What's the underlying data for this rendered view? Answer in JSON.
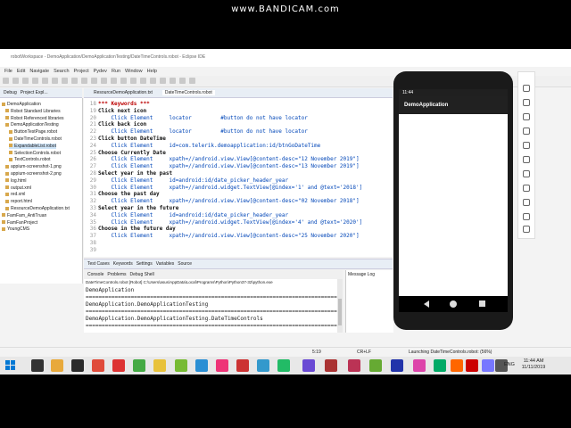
{
  "watermark": "www.BANDICAM.com",
  "window_title": "robotWorkspace - DemoApplication/DemoApplicationTesting/DateTimeControls.robot - Eclipse IDE",
  "menu": [
    "File",
    "Edit",
    "Navigate",
    "Search",
    "Project",
    "Pydev",
    "Run",
    "Window",
    "Help"
  ],
  "explorer_tabs": [
    "Debug",
    "Project Expl..."
  ],
  "explorer_items": [
    "DemoApplication",
    "Robot Standard Libraries",
    "Robot Referenced libraries",
    "DemoApplicationTesting",
    "ButtonTestPage.robot",
    "DateTimeControls.robot",
    "ExpandableList.robot",
    "SelectionControls.robot",
    "TextControls.robot",
    "appium-screenshot-1.png",
    "appium-screenshot-2.png",
    "log.html",
    "output.xml",
    "red.xml",
    "report.html",
    "ResourceDemoApplication.txt",
    "FamFam_AntiTruan",
    "FamFanProject",
    "YoungCMS"
  ],
  "editor_tabs": [
    "ResourceDemoApplication.txt",
    "DateTimeControls.robot"
  ],
  "code_lines": [
    {
      "n": "18",
      "t": "*** Keywords ***",
      "cls": "kw"
    },
    {
      "n": "19",
      "t": "Click next icon",
      "cls": "hdr"
    },
    {
      "n": "20",
      "t": "    Click Element     locator         #button do not have locator",
      "cls": "blue"
    },
    {
      "n": "21",
      "t": "Click back icon",
      "cls": "hdr"
    },
    {
      "n": "22",
      "t": "    Click Element     locator         #button do not have locator",
      "cls": "blue"
    },
    {
      "n": "23",
      "t": "Click button DateTime",
      "cls": "hdr"
    },
    {
      "n": "24",
      "t": "    Click Element     id=com.telerik.demoapplication:id/btnGoDateTime",
      "cls": "blue"
    },
    {
      "n": "25",
      "t": "Choose Currently Date",
      "cls": "hdr"
    },
    {
      "n": "26",
      "t": "    Click Element     xpath=//android.view.View[@content-desc=\"12 November 2019\"]",
      "cls": "blue"
    },
    {
      "n": "27",
      "t": "    Click Element     xpath=//android.view.View[@content-desc=\"13 November 2019\"]",
      "cls": "blue"
    },
    {
      "n": "28",
      "t": "Select year in the past",
      "cls": "hdr"
    },
    {
      "n": "29",
      "t": "    Click Element     id=android:id/date_picker_header_year",
      "cls": "blue"
    },
    {
      "n": "30",
      "t": "    Click Element     xpath=//android.widget.TextView[@index='1' and @text='2018']",
      "cls": "blue"
    },
    {
      "n": "31",
      "t": "Choose the past day",
      "cls": "hdr"
    },
    {
      "n": "32",
      "t": "    Click Element     xpath=//android.view.View[@content-desc=\"02 November 2018\"]",
      "cls": "blue"
    },
    {
      "n": "33",
      "t": "Select year in the future",
      "cls": "hdr"
    },
    {
      "n": "34",
      "t": "    Click Element     id=android:id/date_picker_header_year",
      "cls": "blue"
    },
    {
      "n": "35",
      "t": "    Click Element     xpath=//android.widget.TextView[@index='4' and @text='2020']",
      "cls": "blue"
    },
    {
      "n": "36",
      "t": "Choose in the future day",
      "cls": "hdr"
    },
    {
      "n": "37",
      "t": "    Click Element     xpath=//android.view.View[@content-desc=\"25 November 2020\"]",
      "cls": "blue"
    },
    {
      "n": "38",
      "t": "",
      "cls": ""
    },
    {
      "n": "39",
      "t": "",
      "cls": ""
    }
  ],
  "bottom_tabs": [
    "Test Cases",
    "Keywords",
    "Settings",
    "Variables",
    "Source"
  ],
  "console_tabs": [
    "Console",
    "Problems",
    "Debug Shell"
  ],
  "console_header": "DateTimeControls.robot [Robot] C:\\Users\\asus\\AppData\\Local\\Programs\\Python\\Python37-32\\python.exe",
  "console_lines": [
    "DemoApplication",
    "==============================================================================",
    "DemoApplication.DemoApplicationTesting",
    "==============================================================================",
    "DemoApplication.DemoApplicationTesting.DateTimeControls",
    "=============================================================================="
  ],
  "message_log": "Message Log",
  "status": {
    "position": "5:19",
    "encoding": "CR+LF",
    "launch": "Launching DateTimeControls.robot: (56%)"
  },
  "phone": {
    "time": "11:44",
    "app_title": "DemoApplication"
  },
  "taskbar": {
    "lang": "ENG",
    "time": "11:44 AM",
    "date": "11/11/2019"
  }
}
